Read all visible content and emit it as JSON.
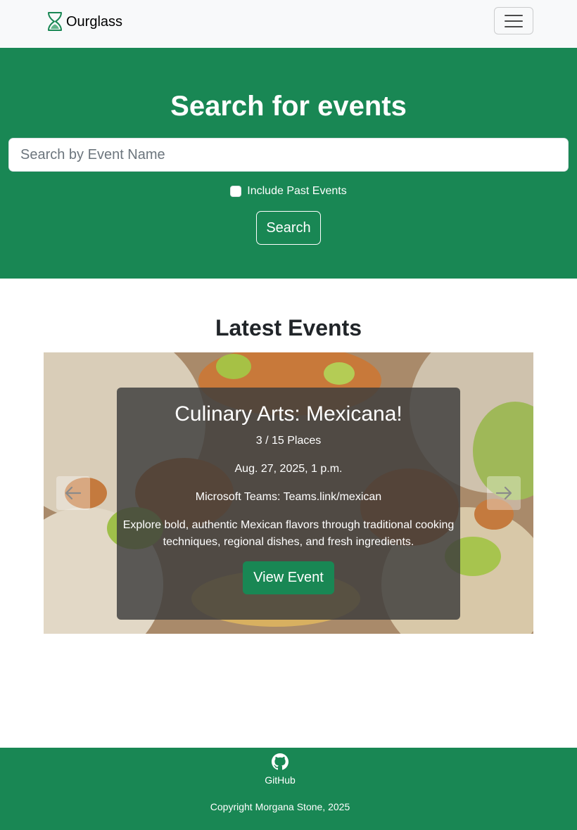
{
  "navbar": {
    "brand": "Ourglass",
    "brand_icon": "hourglass-icon",
    "toggler_icon": "hamburger-menu-icon"
  },
  "hero": {
    "title": "Search for events",
    "search": {
      "placeholder": "Search by Event Name",
      "value": ""
    },
    "include_past_label": "Include Past Events",
    "include_past_checked": false,
    "search_button": "Search",
    "background": "#198754"
  },
  "latest": {
    "title": "Latest Events",
    "slide": {
      "title": "Culinary Arts: Mexicana!",
      "places": "3 / 15 Places",
      "date": "Aug. 27, 2025, 1 p.m.",
      "location": "Microsoft Teams: Teams.link/mexican",
      "description": "Explore bold, authentic Mexican flavors through traditional cooking techniques, regional dishes, and fresh ingredients.",
      "button": "View Event"
    },
    "slide_count": 5,
    "active_slide": 1,
    "prev_icon": "arrow-left-icon",
    "next_icon": "arrow-right-icon"
  },
  "footer": {
    "github_label": "GitHub",
    "github_icon": "github-icon",
    "copyright": "Copyright Morgana Stone, 2025"
  },
  "colors": {
    "primary": "#198754",
    "navbar_bg": "#f8f9fa"
  }
}
